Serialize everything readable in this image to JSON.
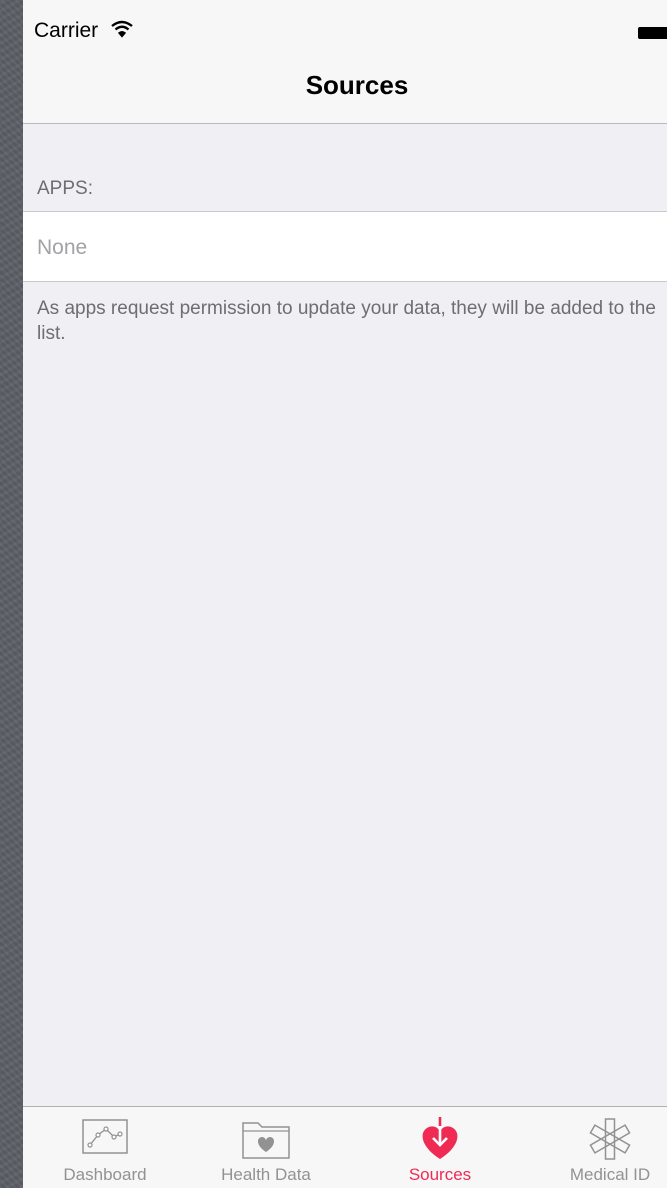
{
  "status_bar": {
    "carrier": "Carrier"
  },
  "nav": {
    "title": "Sources"
  },
  "apps_section": {
    "header": "APPS:",
    "items": [
      {
        "label": "None"
      }
    ],
    "footer": "As apps request permission to update your data, they will be added to the list."
  },
  "tab_bar": {
    "tabs": [
      {
        "label": "Dashboard",
        "icon": "dashboard-icon",
        "active": false
      },
      {
        "label": "Health Data",
        "icon": "health-data-icon",
        "active": false
      },
      {
        "label": "Sources",
        "icon": "sources-icon",
        "active": true
      },
      {
        "label": "Medical ID",
        "icon": "medical-id-icon",
        "active": false
      }
    ]
  },
  "colors": {
    "accent": "#ef2b54",
    "inactive": "#929292",
    "background": "#efeff4"
  }
}
